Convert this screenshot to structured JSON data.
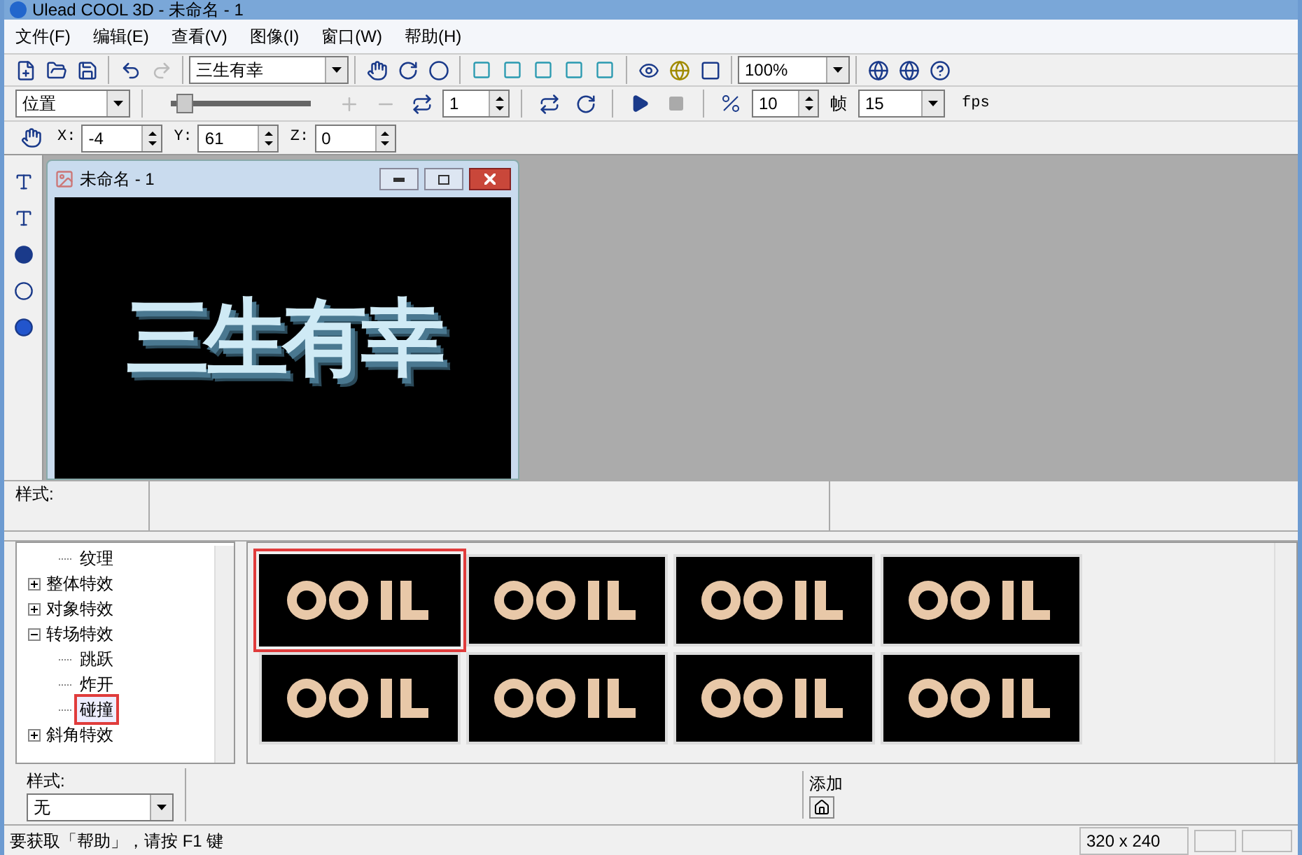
{
  "window": {
    "title": "Ulead COOL 3D - 未命名 - 1"
  },
  "menu": [
    "文件(F)",
    "编辑(E)",
    "查看(V)",
    "图像(I)",
    "窗口(W)",
    "帮助(H)"
  ],
  "toolbar": {
    "text_combo": "三生有幸",
    "zoom_combo": "100%"
  },
  "animation_bar": {
    "property_combo": "位置",
    "slider": {
      "level": 0.05
    },
    "frame_field": "1",
    "speed_field": "10",
    "frame_label": "帧",
    "fps_combo": "15",
    "fps_label": "fps"
  },
  "position_bar": {
    "fields": [
      {
        "label": "X:",
        "value": "-4"
      },
      {
        "label": "Y:",
        "value": "61"
      },
      {
        "label": "Z:",
        "value": "0"
      }
    ]
  },
  "document": {
    "title": "未命名 - 1",
    "canvas_text": "三生有幸"
  },
  "style_bar": {
    "label": "样式:"
  },
  "tree": [
    {
      "kind": "leaf",
      "label": "纹理",
      "selected": false
    },
    {
      "kind": "group",
      "label": "整体特效",
      "expanded": false
    },
    {
      "kind": "group",
      "label": "对象特效",
      "expanded": false
    },
    {
      "kind": "group",
      "label": "转场特效",
      "expanded": true,
      "children": [
        {
          "kind": "leaf",
          "label": "跳跃",
          "selected": false
        },
        {
          "kind": "leaf",
          "label": "炸开",
          "selected": false
        },
        {
          "kind": "leaf",
          "label": "碰撞",
          "selected": true
        }
      ]
    },
    {
      "kind": "group",
      "label": "斜角特效",
      "expanded": false
    }
  ],
  "thumbnails": [
    {
      "selected": true
    },
    {
      "selected": false
    },
    {
      "selected": false
    },
    {
      "selected": false
    },
    {
      "selected": false
    },
    {
      "selected": false
    },
    {
      "selected": false
    },
    {
      "selected": false
    }
  ],
  "bottom": {
    "style_label": "样式:",
    "style_combo": "无",
    "add_button": "添加"
  },
  "status_bar": {
    "message": "要获取「帮助」，请按 F1 键",
    "size": "320 x 240"
  }
}
